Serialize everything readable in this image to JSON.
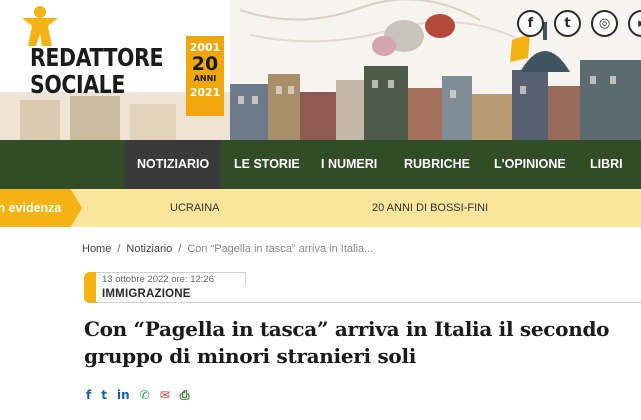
{
  "logo": {
    "line1": "REDATTORE",
    "line2": "SOCIALE",
    "year_start": "2001",
    "number": "20",
    "anni": "ANNI",
    "year_end": "2021"
  },
  "social": [
    {
      "name": "facebook-icon",
      "glyph": "f"
    },
    {
      "name": "twitter-icon",
      "glyph": "t"
    },
    {
      "name": "instagram-icon",
      "glyph": "◎"
    },
    {
      "name": "extra-social-icon",
      "glyph": "▸"
    }
  ],
  "nav": {
    "items": [
      "NOTIZIARIO",
      "LE STORIE",
      "I NUMERI",
      "RUBRICHE",
      "L'OPINIONE",
      "LIBRI"
    ],
    "active": "NOTIZIARIO"
  },
  "evidence": {
    "label": "In evidenza",
    "links": [
      "UCRAINA",
      "20 ANNI DI BOSSI-FINI"
    ]
  },
  "breadcrumb": {
    "home": "Home",
    "section": "Notiziario",
    "current": "Con “Pagella in tasca” arriva in Italia..."
  },
  "article": {
    "date": "13 ottobre 2022 ore: 12:26",
    "category": "IMMIGRAZIONE",
    "title": "Con “Pagella in tasca” arriva in Italia il secondo gruppo di minori stranieri soli"
  },
  "share": [
    {
      "name": "share-facebook-icon",
      "glyph": "f"
    },
    {
      "name": "share-twitter-icon",
      "glyph": "t"
    },
    {
      "name": "share-linkedin-icon",
      "glyph": "in"
    },
    {
      "name": "share-whatsapp-icon",
      "glyph": "✆"
    },
    {
      "name": "share-email-icon",
      "glyph": "✉"
    },
    {
      "name": "share-print-icon",
      "glyph": "⎙"
    }
  ],
  "colors": {
    "nav_bg": "#304d27",
    "nav_active_bg": "#3a3a3a",
    "accent_yellow": "#f4b312",
    "evidence_bg": "#fbe49c"
  }
}
